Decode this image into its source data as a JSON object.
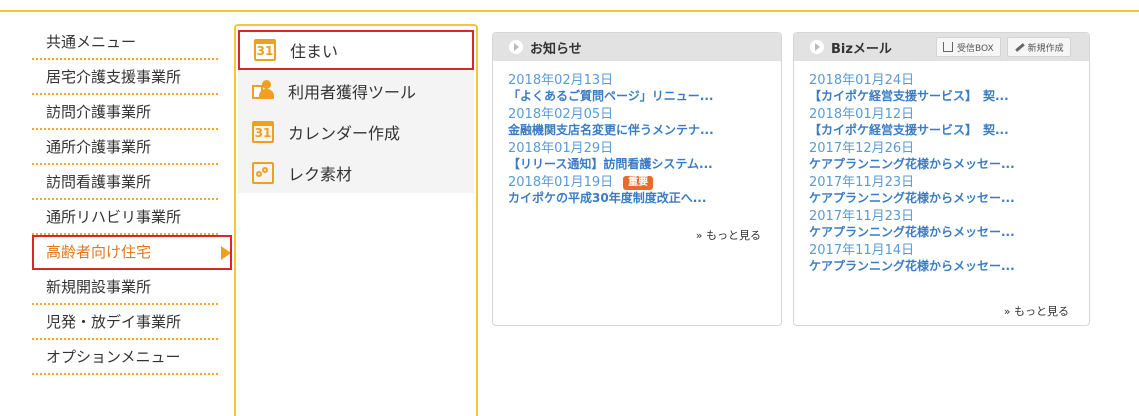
{
  "left_menu": {
    "items": [
      {
        "label": "共通メニュー"
      },
      {
        "label": "居宅介護支援事業所"
      },
      {
        "label": "訪問介護事業所"
      },
      {
        "label": "通所介護事業所"
      },
      {
        "label": "訪問看護事業所"
      },
      {
        "label": "通所リハビリ事業所"
      },
      {
        "label": "高齢者向け住宅",
        "active": true
      },
      {
        "label": "新規開設事業所"
      },
      {
        "label": "児発・放デイ事業所"
      },
      {
        "label": "オプションメニュー"
      }
    ]
  },
  "sub_menu": {
    "items": [
      {
        "label": "住まい",
        "icon": "calendar-icon",
        "icon_text": "31"
      },
      {
        "label": "利用者獲得ツール",
        "icon": "user-board-icon"
      },
      {
        "label": "カレンダー作成",
        "icon": "calendar-icon",
        "icon_text": "31"
      },
      {
        "label": "レク素材",
        "icon": "recreation-icon"
      }
    ]
  },
  "news": {
    "title": "お知らせ",
    "entries": [
      {
        "date": "2018年02月13日",
        "title": "「よくあるご質問ページ」リニュー..."
      },
      {
        "date": "2018年02月05日",
        "title": "金融機関支店名変更に伴うメンテナ..."
      },
      {
        "date": "2018年01月29日",
        "title": "【リリース通知】訪問看護システム..."
      },
      {
        "date": "2018年01月19日",
        "title": "カイポケの平成30年度制度改正へ...",
        "badge": "重要"
      }
    ],
    "more": "» もっと見る"
  },
  "biz_mail": {
    "title": "Bizメール",
    "inbox_button": "受信BOX",
    "compose_button": "新規作成",
    "entries": [
      {
        "date": "2018年01月24日",
        "title": "【カイポケ経営支援サービス】　契..."
      },
      {
        "date": "2018年01月12日",
        "title": "【カイポケ経営支援サービス】　契..."
      },
      {
        "date": "2017年12月26日",
        "title": "ケアプランニング花様からメッセー..."
      },
      {
        "date": "2017年11月23日",
        "title": "ケアプランニング花様からメッセー..."
      },
      {
        "date": "2017年11月23日",
        "title": "ケアプランニング花様からメッセー..."
      },
      {
        "date": "2017年11月14日",
        "title": "ケアプランニング花様からメッセー..."
      }
    ],
    "more": "» もっと見る"
  },
  "colors": {
    "accent": "#f5c53a",
    "highlight_border": "#d8262c",
    "link": "#3a7cc4",
    "badge": "#e86a30"
  }
}
